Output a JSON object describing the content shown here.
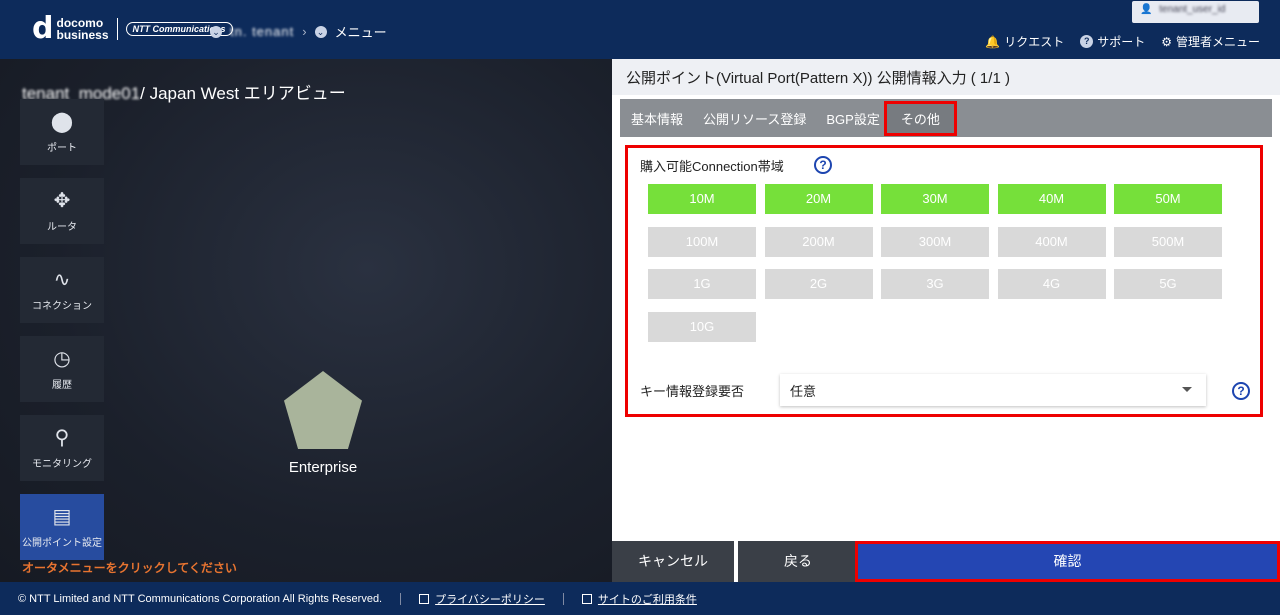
{
  "header": {
    "logo_main": "d",
    "logo_line1": "docomo",
    "logo_line2": "business",
    "logo_ntt": "NTT Communications",
    "breadcrumb_tenant": "tn. tenant",
    "breadcrumb_menu": "メニュー",
    "user_name": "tenant_user_id",
    "nav": {
      "request": "リクエスト",
      "support": "サポート",
      "admin_menu": "管理者メニュー"
    }
  },
  "map": {
    "tenant": "tenant_mode01",
    "title_suffix": "/ Japan West エリアビュー",
    "side_menu": [
      {
        "label": "ポート",
        "icon": "port-icon"
      },
      {
        "label": "ルータ",
        "icon": "router-icon"
      },
      {
        "label": "コネクション",
        "icon": "connection-icon"
      },
      {
        "label": "履歴",
        "icon": "history-icon"
      },
      {
        "label": "モニタリング",
        "icon": "monitoring-icon"
      },
      {
        "label": "公開ポイント設定",
        "icon": "public-point-icon"
      }
    ],
    "node_label": "Enterprise",
    "hint": "オータメニューをクリックしてください"
  },
  "panel": {
    "title": "公開ポイント(Virtual Port(Pattern X)) 公開情報入力 ( 1/1 )",
    "tabs": [
      "基本情報",
      "公開リソース登録",
      "BGP設定",
      "その他"
    ],
    "active_tab": "その他",
    "bandwidth_label": "購入可能Connection帯域",
    "help": "?",
    "bandwidths": [
      {
        "label": "10M",
        "selected": true
      },
      {
        "label": "20M",
        "selected": true
      },
      {
        "label": "30M",
        "selected": true
      },
      {
        "label": "40M",
        "selected": true
      },
      {
        "label": "50M",
        "selected": true
      },
      {
        "label": "100M",
        "selected": false
      },
      {
        "label": "200M",
        "selected": false
      },
      {
        "label": "300M",
        "selected": false
      },
      {
        "label": "400M",
        "selected": false
      },
      {
        "label": "500M",
        "selected": false
      },
      {
        "label": "1G",
        "selected": false
      },
      {
        "label": "2G",
        "selected": false
      },
      {
        "label": "3G",
        "selected": false
      },
      {
        "label": "4G",
        "selected": false
      },
      {
        "label": "5G",
        "selected": false
      },
      {
        "label": "10G",
        "selected": false
      }
    ],
    "key_label": "キー情報登録要否",
    "key_value": "任意",
    "buttons": {
      "cancel": "キャンセル",
      "back": "戻る",
      "confirm": "確認"
    }
  },
  "footer": {
    "copyright": "© NTT Limited and NTT Communications Corporation All Rights Reserved.",
    "privacy": "プライバシーポリシー",
    "terms": "サイトのご利用条件"
  },
  "colors": {
    "header_bg": "#0d2b5b",
    "selected_green": "#76e03a",
    "unselected_gray": "#d9d9d9",
    "confirm_blue": "#2446b3",
    "highlight_red": "#ee0000",
    "hint_orange": "#e87430"
  }
}
